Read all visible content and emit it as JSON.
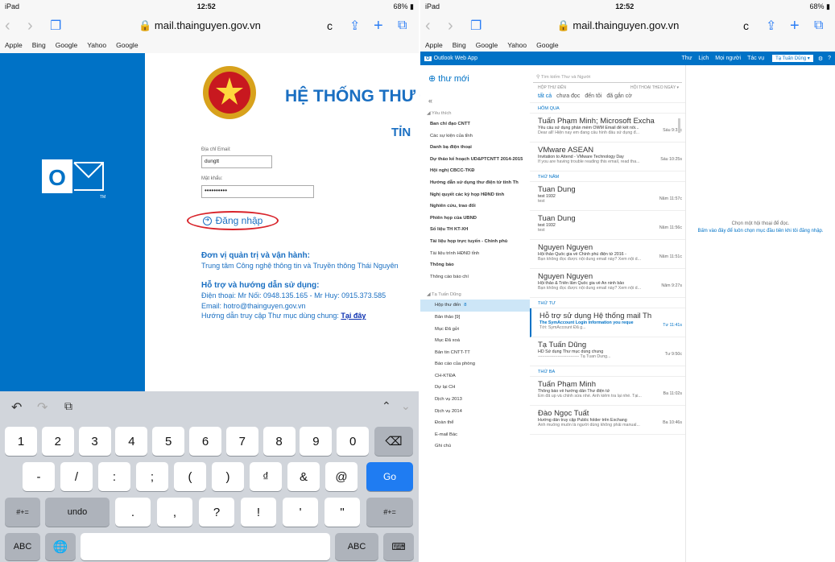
{
  "left": {
    "status": {
      "device": "iPad",
      "time": "12:52",
      "battery": "68%"
    },
    "url": "mail.thainguyen.gov.vn",
    "bookmarks": [
      "Apple",
      "Bing",
      "Google",
      "Yahoo",
      "Google"
    ],
    "banner_title": "HỆ THỐNG THƯ ĐI",
    "banner_sub": "TỈN",
    "username_label": "Địa chỉ Email:",
    "username_value": "dungtt",
    "password_label": "Mật khẩu:",
    "password_value": "••••••••••",
    "login_label": "Đăng nhập",
    "admin_heading": "Đơn vị quản trị và vận hành:",
    "admin_text": "Trung tâm Công nghệ thông tin và Truyền thông Thái Nguyên",
    "support_heading": "Hỗ trợ và hướng dẫn sử dụng:",
    "support_phone": "Điện thoại: Mr Nối: 0948.135.165 - Mr Huy: 0915.373.585",
    "support_email": "Email: hotro@thainguyen.gov.vn",
    "support_guide": "Hướng dẫn truy cập Thư mục dùng chung:",
    "support_link": "Tại đây",
    "keyboard": {
      "row1": [
        "1",
        "2",
        "3",
        "4",
        "5",
        "6",
        "7",
        "8",
        "9",
        "0"
      ],
      "row2": [
        "-",
        "/",
        ":",
        ";",
        "(",
        ")",
        "₫",
        "&",
        "@"
      ],
      "go": "Go",
      "row3_left": "#+=",
      "undo": "undo",
      "row3": [
        ".",
        ",",
        "?",
        "!",
        "'",
        "\""
      ],
      "row3_right": "#+=",
      "abc": "ABC"
    }
  },
  "right": {
    "status": {
      "device": "iPad",
      "time": "12:52",
      "battery": "68%"
    },
    "url": "mail.thainguyen.gov.vn",
    "bookmarks": [
      "Apple",
      "Bing",
      "Google",
      "Yahoo",
      "Google"
    ],
    "app_name": "Outlook Web App",
    "nav": [
      "Thư",
      "Lịch",
      "Mọi người",
      "Tác vụ"
    ],
    "user": "Tạ Tuấn Dũng",
    "new_mail": "thư mới",
    "search_placeholder": "Tìm kiếm Thư và Người",
    "inbox_label": "HỘP THƯ ĐẾN",
    "sort_label": "HỘI THOẠI THEO NGÀY",
    "filters": {
      "all": "tất cả",
      "unread": "chưa đọc",
      "to_me": "đến tôi",
      "flagged": "đã gắn cờ"
    },
    "favorites_header": "Yêu thích",
    "favorites": [
      {
        "name": "Ban chỉ đạo CNTT",
        "bold": true
      },
      {
        "name": "Các sự kiện của tỉnh",
        "bold": false
      },
      {
        "name": "Danh bạ điện thoại",
        "bold": true
      },
      {
        "name": "Dự thảo kế hoạch UD&PTCNTT 2014-2015",
        "bold": true
      },
      {
        "name": "Hội nghị CBCC-TKĐ",
        "bold": true
      },
      {
        "name": "Hướng dẫn sử dụng thư điện tử tỉnh Th",
        "bold": true
      },
      {
        "name": "Nghị quyết các kỳ họp HĐND tỉnh",
        "bold": true
      },
      {
        "name": "Nghiên cứu, trao đổi",
        "bold": true
      },
      {
        "name": "Phiên họp của UBND",
        "bold": true
      },
      {
        "name": "Số liệu TH KT-XH",
        "bold": true
      },
      {
        "name": "Tài liệu họp trực tuyến - Chính phủ",
        "bold": true
      },
      {
        "name": "Tài liệu trình HĐND tỉnh",
        "bold": false
      },
      {
        "name": "Thông báo",
        "bold": true
      },
      {
        "name": "Thông cáo báo chí",
        "bold": false
      }
    ],
    "mailbox_owner": "Tạ Tuấn Dũng",
    "folders": [
      {
        "name": "Hộp thư đến",
        "count": "8",
        "selected": true
      },
      {
        "name": "Bản thảo [9]",
        "count": "",
        "selected": false
      },
      {
        "name": "Mục Đã gửi",
        "count": "",
        "selected": false
      },
      {
        "name": "Mục Đã xoá",
        "count": "",
        "selected": false
      },
      {
        "name": "Bản tin CNTT-TT",
        "count": "",
        "selected": false
      },
      {
        "name": "Báo cáo của phòng",
        "count": "",
        "selected": false
      },
      {
        "name": "CH-KTĐA",
        "count": "",
        "selected": false
      },
      {
        "name": "Dự lại CH",
        "count": "",
        "selected": false
      },
      {
        "name": "Dịch vụ 2013",
        "count": "",
        "selected": false
      },
      {
        "name": "Dịch vụ 2014",
        "count": "",
        "selected": false
      },
      {
        "name": "Đoàn thể",
        "count": "",
        "selected": false
      },
      {
        "name": "E-mail Bác",
        "count": "",
        "selected": false
      },
      {
        "name": "Ghi chú",
        "count": "",
        "selected": false
      }
    ],
    "groups": [
      {
        "label": "HÔM QUA",
        "messages": [
          {
            "from": "Tuấn Phạm Minh; Microsoft Excha",
            "subject": "Yêu cầu sử dụng phần mềm OWM Email để kết nối...",
            "preview": "Dear all! Hiện nay em đang cấu hình đầu sử dụng đ...",
            "time": "Sáu 9:31c"
          },
          {
            "from": "VMware ASEAN",
            "subject": "Invitation to Attend - VMware Technology Day",
            "preview": "If you are having trouble reading this email, read tha...",
            "time": "Sáu 10:25s"
          }
        ]
      },
      {
        "label": "THỨ NĂM",
        "messages": [
          {
            "from": "Tuan Dung",
            "subject": "test 1932",
            "preview": "test",
            "time": "Năm 11:57c"
          },
          {
            "from": "Tuan Dung",
            "subject": "test 1932",
            "preview": "test",
            "time": "Năm 11:56c"
          },
          {
            "from": "Nguyen Nguyen",
            "subject": "Hội thảo Quốc gia về Chính phủ điện tử 2016 -",
            "preview": "Bạn không đọc được nội dung email này? Xem nội d...",
            "time": "Năm 11:51c"
          },
          {
            "from": "Nguyen Nguyen",
            "subject": "Hội thảo & Triển lãm Quốc gia về An ninh bảo",
            "preview": "Bạn không đọc được nội dung email này? Xem nội d...",
            "time": "Năm 9:27s"
          }
        ]
      },
      {
        "label": "THỨ TƯ",
        "messages": [
          {
            "from": "Hỗ trợ sử dụng Hệ thống mail Th",
            "subject": "The SymAccount Login Information you reque",
            "preview": "Tới: SymAccount Đã g...",
            "time": "Tư 11:41s",
            "blue": true
          },
          {
            "from": "Tạ Tuấn Dũng",
            "subject": "HD Sử dụng Thư mục dùng chung",
            "preview": "----------------------------- Tạ Tuan Dung...",
            "time": "Tư 9:50c"
          }
        ]
      },
      {
        "label": "THỨ BA",
        "messages": [
          {
            "from": "Tuấn Phạm Minh",
            "subject": "Thông báo về hướng dẫn Thư điện tử",
            "preview": "Em đã up và chỉnh sửa nhé. Anh kiểm tra lại nhé. Tại...",
            "time": "Ba 11:02s"
          },
          {
            "from": "Đào Ngọc Tuất",
            "subject": "Hướng dẫn truy cập Public folder trên Exchang",
            "preview": "Anh muống muốn là người dùng không phải manual...",
            "time": "Ba 10:46s"
          }
        ]
      }
    ],
    "reading_title": "Chọn một hội thoại để đọc.",
    "reading_link": "Bấm vào đây để luôn chọn mục đầu tiên khi tôi đăng nhập."
  }
}
